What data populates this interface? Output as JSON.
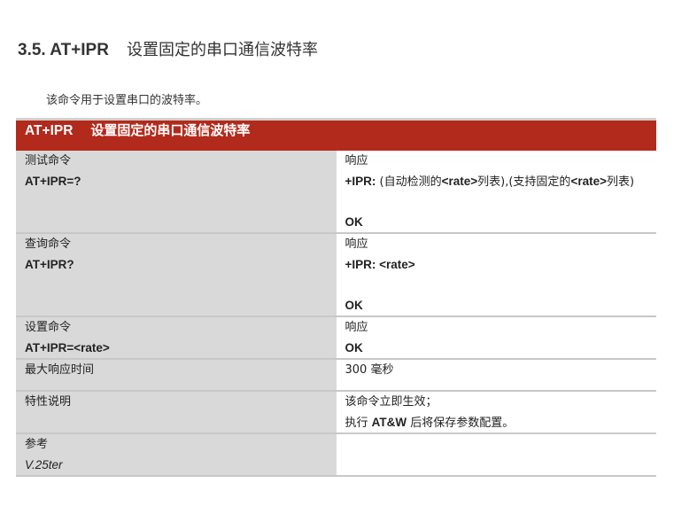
{
  "section": {
    "number": "3.5. AT+IPR",
    "title": "设置固定的串口通信波特率"
  },
  "intro": "该命令用于设置串口的波特率。",
  "table": {
    "header_cmd": "AT+IPR",
    "header_desc": "设置固定的串口通信波特率",
    "test": {
      "label": "测试命令",
      "command": "AT+IPR=?",
      "response_label": "响应",
      "response_prefix": "+IPR:",
      "response_p1": " (自动检测的",
      "response_rate1": "<rate>",
      "response_p2": "列表),(支持固定的",
      "response_rate2": "<rate>",
      "response_p3": "列表)",
      "ok": "OK"
    },
    "query": {
      "label": "查询命令",
      "command": "AT+IPR?",
      "response_label": "响应",
      "response": "+IPR: <rate>",
      "ok": "OK"
    },
    "set": {
      "label": "设置命令",
      "command": "AT+IPR=<rate>",
      "response_label": "响应",
      "ok": "OK"
    },
    "max_time": {
      "label": "最大响应时间",
      "value": "300 毫秒"
    },
    "features": {
      "label": "特性说明",
      "line1": "该命令立即生效；",
      "line2_pre": "执行 ",
      "line2_cmd": "AT&W",
      "line2_post": " 后将保存参数配置。"
    },
    "reference": {
      "label": "参考",
      "value": "V.25ter"
    }
  }
}
